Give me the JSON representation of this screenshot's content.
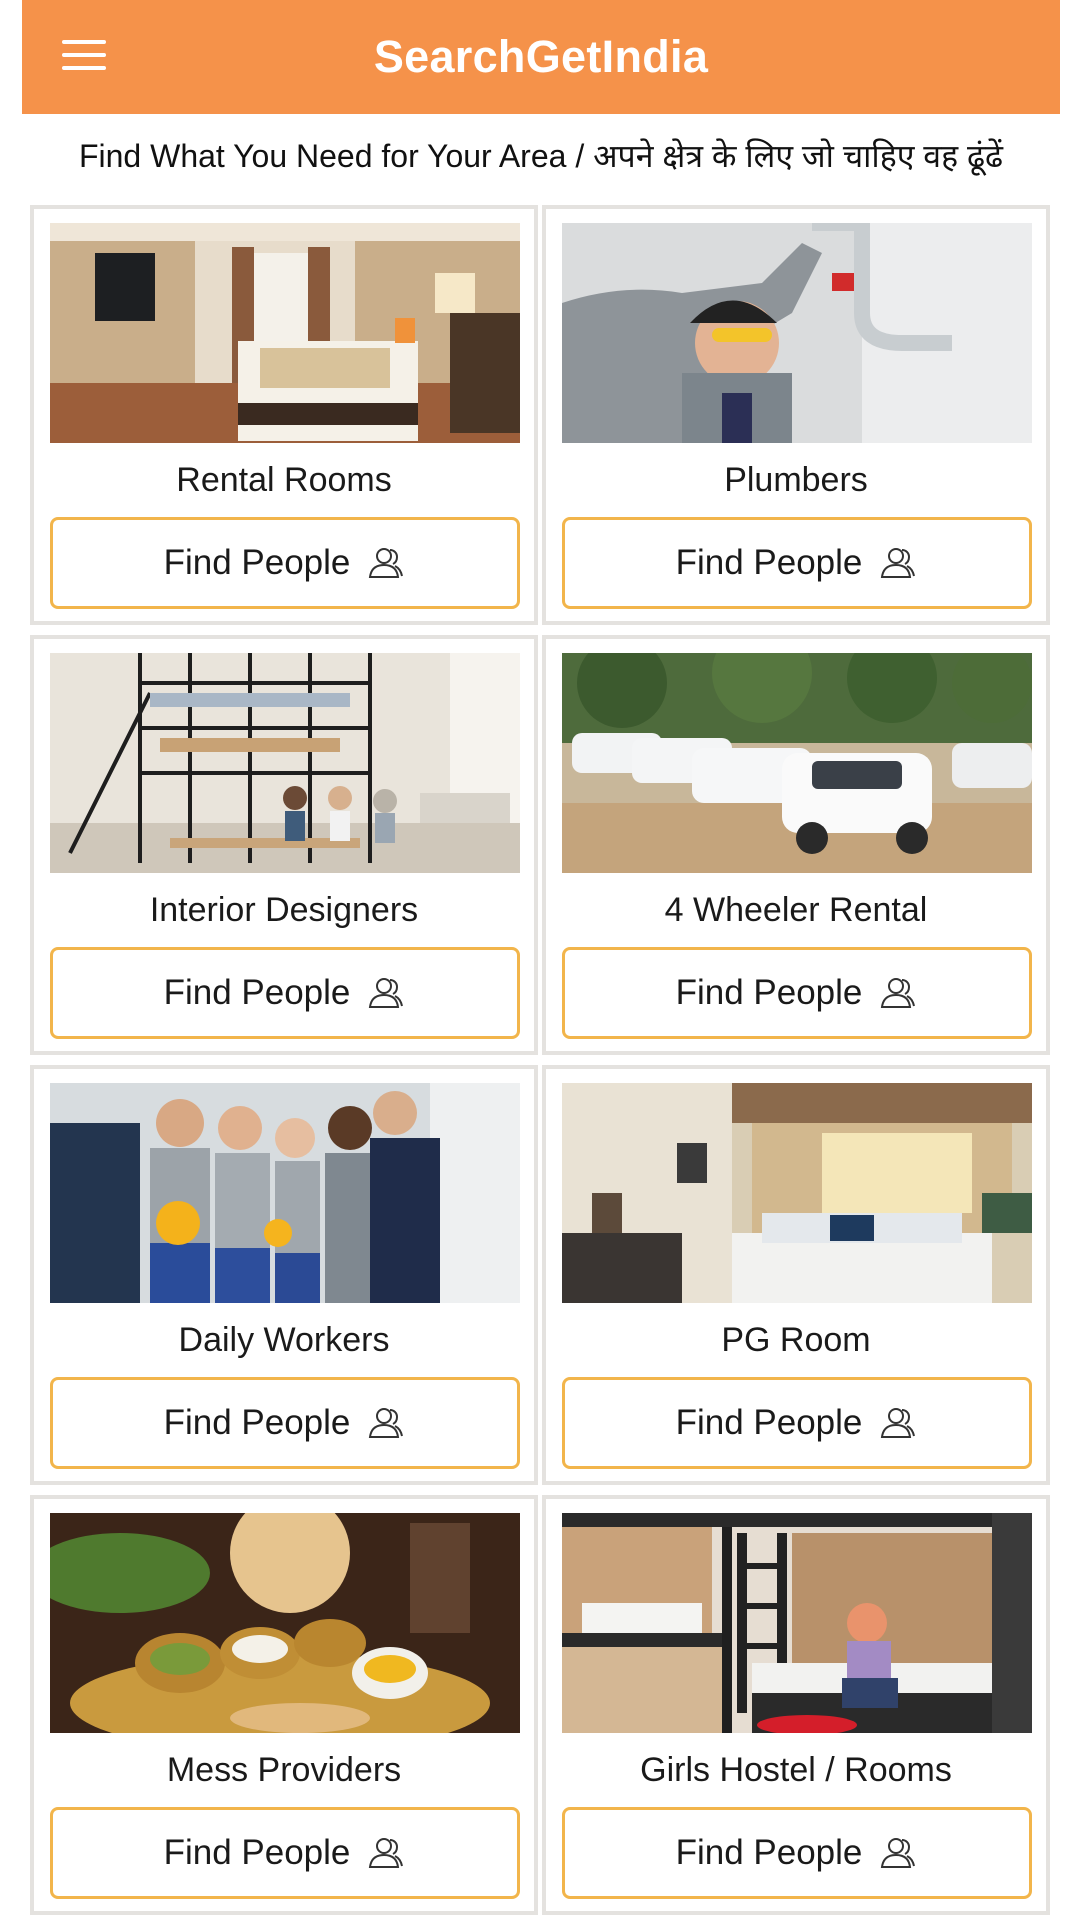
{
  "appbar": {
    "title": "SearchGetIndia",
    "menu_icon": "menu-icon",
    "color": "#F5924A"
  },
  "subtitle": "Find What You Need for Your Area  / अपने क्षेत्र के लिए जो चाहिए वह ढूंढें",
  "button_color": "#F2B54B",
  "cards": [
    {
      "title": "Rental Rooms",
      "button": "Find People",
      "image": "bedroom-photo",
      "icon": "people-icon"
    },
    {
      "title": "Plumbers",
      "button": "Find People",
      "image": "plumber-photo",
      "icon": "people-icon"
    },
    {
      "title": "Interior Designers",
      "button": "Find People",
      "image": "office-interior-photo",
      "icon": "people-icon"
    },
    {
      "title": "4 Wheeler Rental",
      "button": "Find People",
      "image": "cars-photo",
      "icon": "people-icon"
    },
    {
      "title": "Daily Workers",
      "button": "Find People",
      "image": "workers-photo",
      "icon": "people-icon"
    },
    {
      "title": "PG Room",
      "button": "Find People",
      "image": "pg-room-photo",
      "icon": "people-icon"
    },
    {
      "title": "Mess Providers",
      "button": "Find People",
      "image": "thali-food-photo",
      "icon": "people-icon"
    },
    {
      "title": "Girls Hostel / Rooms",
      "button": "Find People",
      "image": "hostel-bunk-photo",
      "icon": "people-icon"
    }
  ]
}
